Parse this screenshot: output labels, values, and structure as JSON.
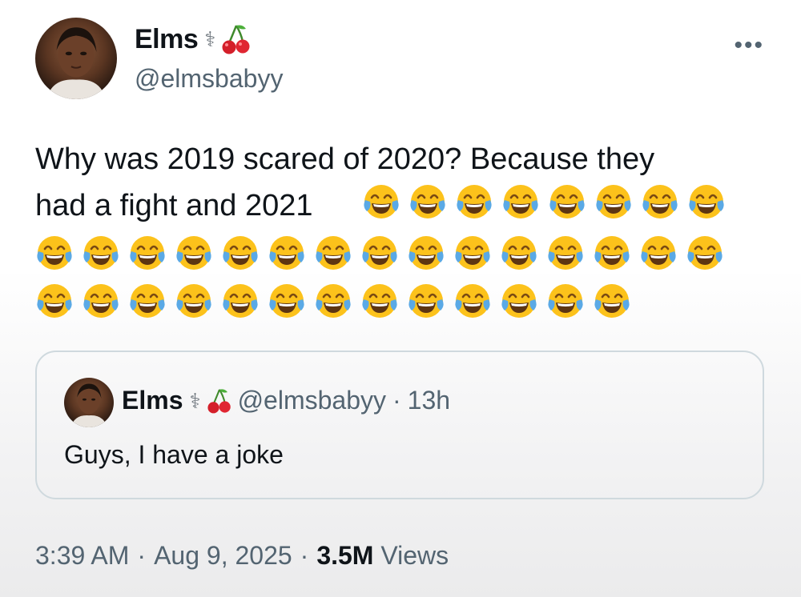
{
  "author": {
    "name": "Elms",
    "handle": "@elmsbabyy",
    "badge_icon": "caduceus-icon",
    "emoji_icon": "cherry-icon"
  },
  "menu": {
    "more_label": "•••"
  },
  "tweet": {
    "text_line1": "Why was 2019 scared of 2020? Because they",
    "text_line2": "had a fight and 2021",
    "emoji": "face-with-tears-of-joy",
    "emoji_counts": {
      "line2": 8,
      "line3": 15,
      "line4": 13
    }
  },
  "quote": {
    "name": "Elms",
    "handle": "@elmsbabyy",
    "separator": "·",
    "time": "13h",
    "text": "Guys, I have a joke"
  },
  "meta": {
    "time": "3:39 AM",
    "sep1": "·",
    "date": "Aug 9, 2025",
    "sep2": "·",
    "views_count": "3.5M",
    "views_label": "Views"
  },
  "colors": {
    "text": "#0f1419",
    "secondary": "#536471",
    "border": "#cfd9de"
  }
}
